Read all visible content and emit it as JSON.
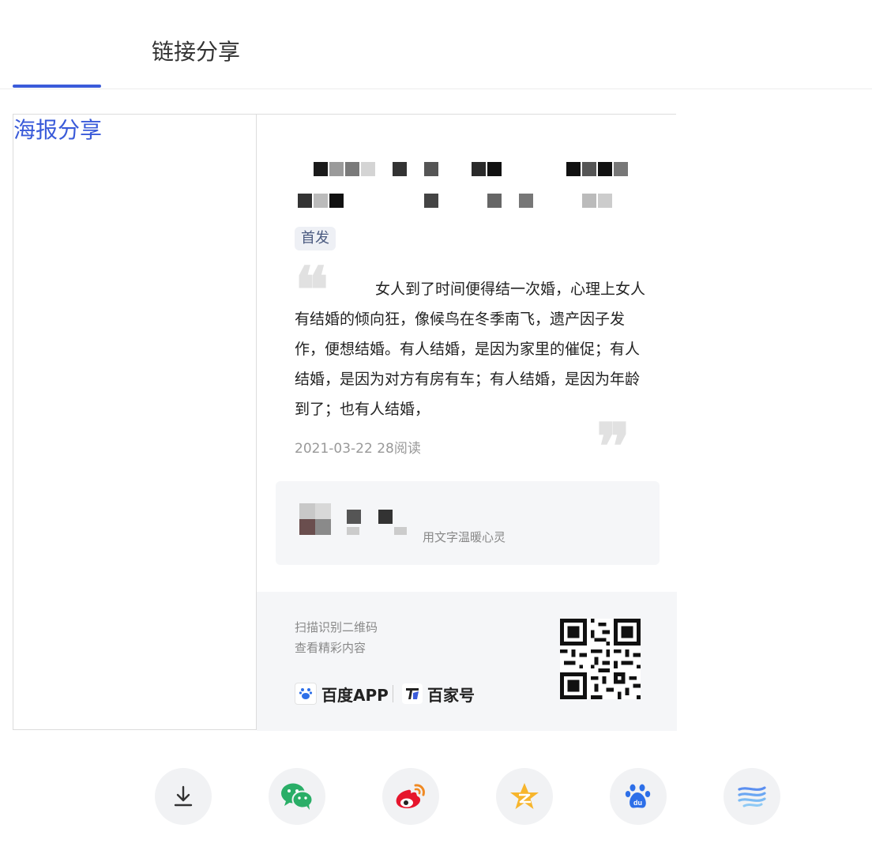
{
  "tabs": [
    {
      "label": "海报分享",
      "active": true
    },
    {
      "label": "链接分享",
      "active": false
    }
  ],
  "poster": {
    "tag": "首发",
    "excerpt": "女人到了时间便得结一次婚，心理上女人有结婚的倾向狂，像候鸟在冬季南飞，遗产因子发作，便想结婚。有人结婚，是因为家里的催促；有人结婚，是因为对方有房有车；有人结婚，是因为年龄到了；也有人结婚，",
    "meta": "2021-03-22 28阅读",
    "author_desc": "用文字温暖心灵",
    "scan_line1": "扫描识别二维码",
    "scan_line2": "查看精彩内容",
    "brand_baidu": "百度APP",
    "brand_bjh": "百家号"
  },
  "share": [
    {
      "name": "download",
      "icon": "download-icon"
    },
    {
      "name": "wechat",
      "icon": "wechat-icon"
    },
    {
      "name": "weibo",
      "icon": "weibo-icon"
    },
    {
      "name": "qzone",
      "icon": "qzone-icon"
    },
    {
      "name": "baidu",
      "icon": "baidu-paw-icon"
    },
    {
      "name": "more",
      "icon": "wave-icon"
    }
  ],
  "colors": {
    "accent": "#3a5bd9",
    "weibo": "#e6162d",
    "wechat": "#2aae67",
    "qzone": "#f7b52c",
    "baidu": "#2d6fe8"
  }
}
